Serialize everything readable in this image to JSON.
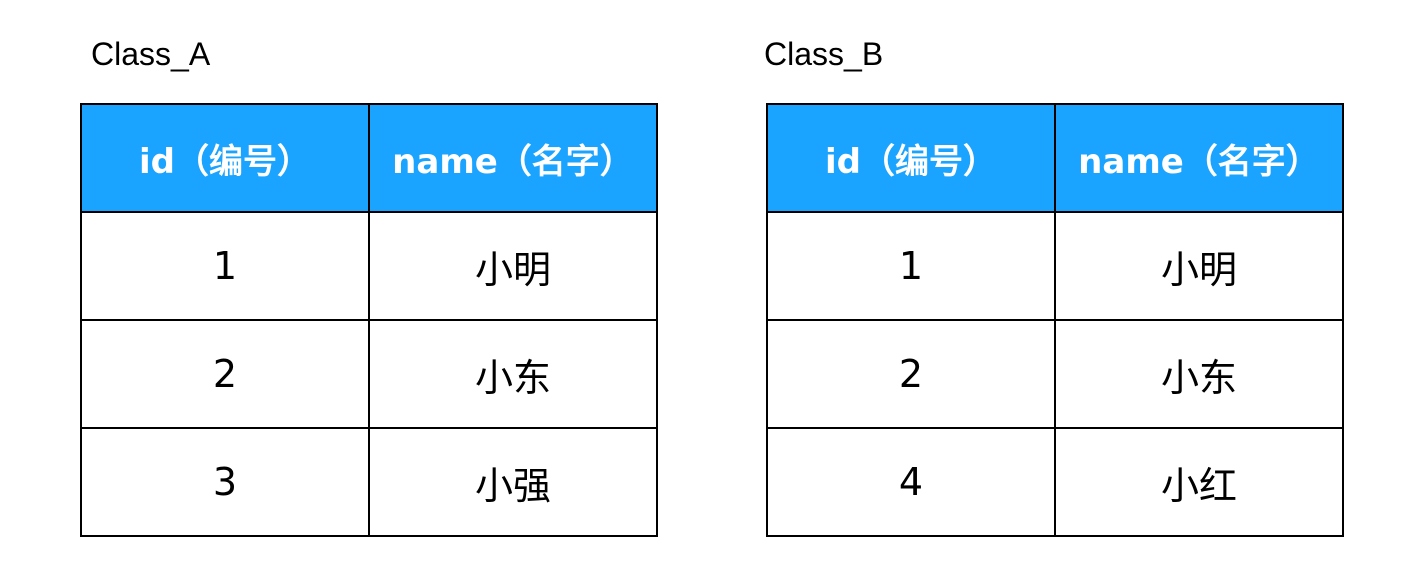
{
  "accent_color": "#1aa3ff",
  "tables": [
    {
      "label": "Class_A",
      "headers": [
        "id（编号）",
        "name（名字）"
      ],
      "rows": [
        [
          "1",
          "小明"
        ],
        [
          "2",
          "小东"
        ],
        [
          "3",
          "小强"
        ]
      ]
    },
    {
      "label": "Class_B",
      "headers": [
        "id（编号）",
        "name（名字）"
      ],
      "rows": [
        [
          "1",
          "小明"
        ],
        [
          "2",
          "小东"
        ],
        [
          "4",
          "小红"
        ]
      ]
    }
  ]
}
